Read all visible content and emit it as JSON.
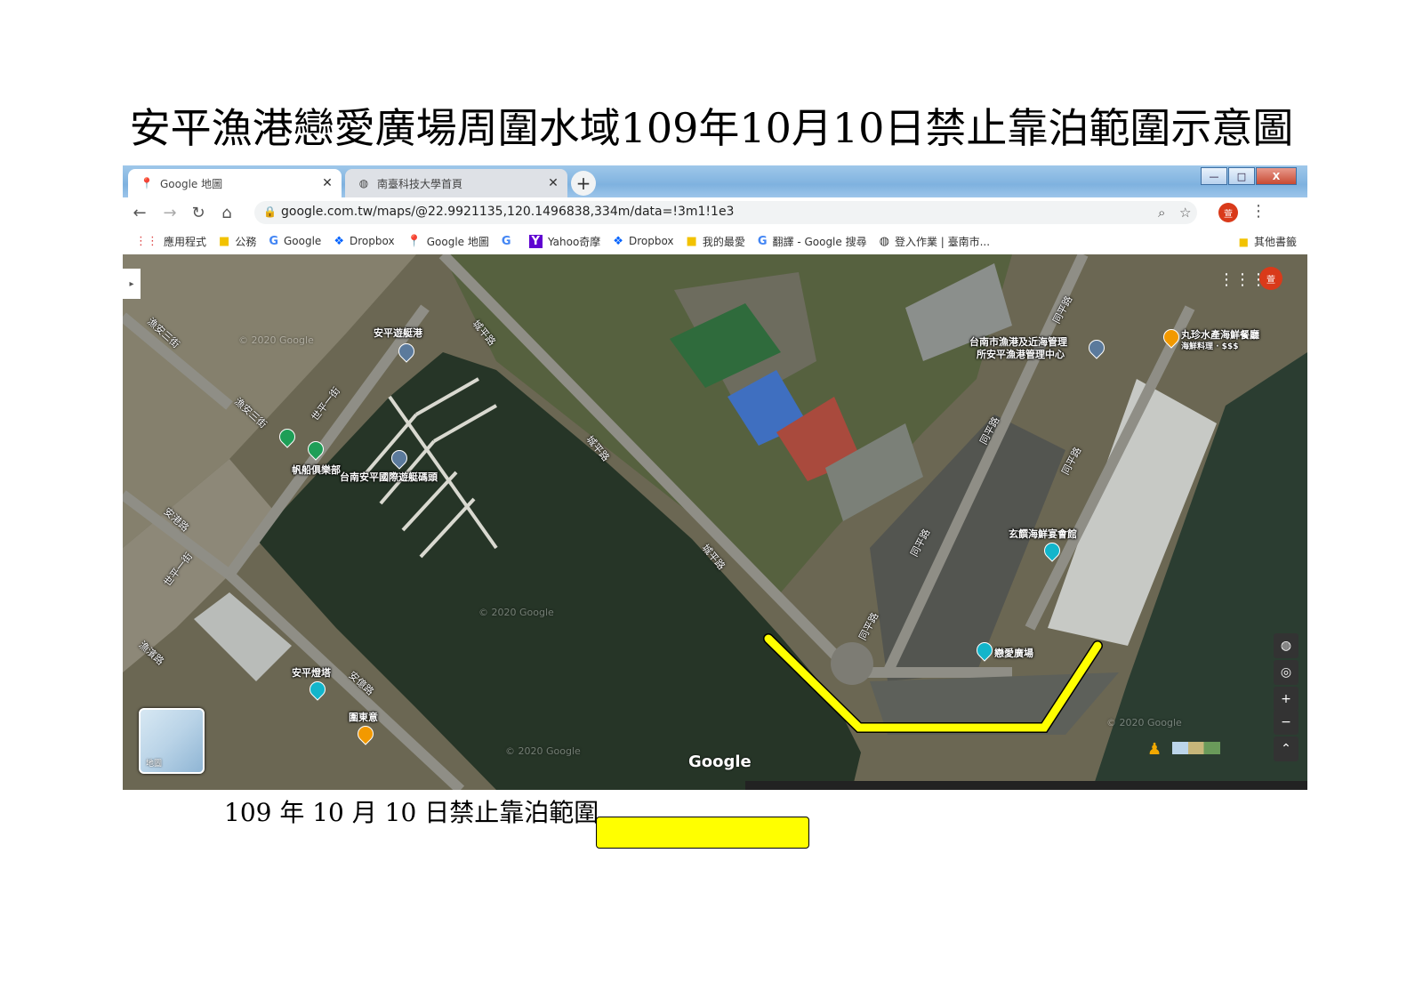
{
  "document": {
    "title": "安平漁港戀愛廣場周圍水域109年10月10日禁止靠泊範圍示意圖",
    "legend_text": "109 年 10 月 10 日禁止靠泊範圍",
    "legend_color": "#ffff00"
  },
  "browser": {
    "tabs": [
      {
        "label": "Google 地圖",
        "icon": "google-maps-pin-icon",
        "active": true
      },
      {
        "label": "南臺科技大學首頁",
        "icon": "globe-icon",
        "active": false
      }
    ],
    "new_tab_label": "+",
    "window_buttons": [
      "—",
      "□",
      "X"
    ],
    "url": "google.com.tw/maps/@22.9921135,120.1496838,334m/data=!3m1!1e3",
    "profile_initial": "萱",
    "bookmarks": [
      {
        "label": "應用程式",
        "icon": "apps-grid-icon"
      },
      {
        "label": "公務",
        "icon": "folder-icon"
      },
      {
        "label": "Google",
        "icon": "google-g-icon"
      },
      {
        "label": "Dropbox",
        "icon": "dropbox-icon"
      },
      {
        "label": "Google 地圖",
        "icon": "google-maps-pin-icon"
      },
      {
        "label": "",
        "icon": "google-g-icon"
      },
      {
        "label": "Yahoo奇摩",
        "icon": "yahoo-icon"
      },
      {
        "label": "Dropbox",
        "icon": "dropbox-icon"
      },
      {
        "label": "我的最愛",
        "icon": "folder-icon"
      },
      {
        "label": "翻譯 - Google 搜尋",
        "icon": "google-g-icon"
      },
      {
        "label": "登入作業 | 臺南市...",
        "icon": "globe-icon"
      }
    ],
    "other_bookmarks": "其他書籤"
  },
  "map": {
    "places": {
      "anping_yacht_harbor": "安平遊艇港",
      "intl_yacht_pier": "台南安平國際遊艇碼頭",
      "sailing_club": "帆船俱樂部",
      "fishery_center_1": "台南市漁港及近海管理",
      "fishery_center_2": "所安平漁港管理中心",
      "restaurant": "丸珍水產海鮮餐廳",
      "restaurant_sub": "海鮮料理 · $$$",
      "banquet": "玄饌海鮮宴會館",
      "love_plaza": "戀愛廣場",
      "lighthouse": "安平燈塔",
      "restaurant2": "圍東意"
    },
    "roads": {
      "yuping1": "漁安三街",
      "yuping2": "漁安三街",
      "shiping": "世平一街",
      "shiping2": "世平一街",
      "anguang": "安港路",
      "yufu": "漁濱路",
      "anping_rd": "安億路",
      "chengping1": "城平路",
      "chengping2": "城平路",
      "chengping3": "城平路",
      "tongping1": "同平路",
      "tongping2": "同平路",
      "tongping3": "同平路",
      "tongping4": "同平路",
      "tongping5": "同平路"
    },
    "watermarks": [
      "© 2020 Google",
      "© 2020 Google",
      "© 2020 Google",
      "© 2020 Google"
    ],
    "google_logo": "Google",
    "thumbnail_label": "地圖",
    "profile_initial": "萱",
    "zoom_in": "+",
    "zoom_out": "−",
    "restricted_zone_color": "#ffff00"
  }
}
